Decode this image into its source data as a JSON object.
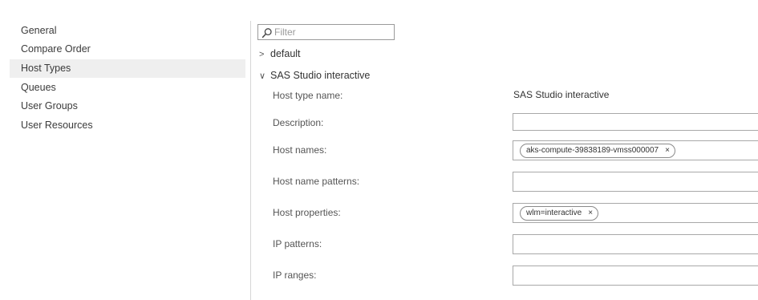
{
  "sidebar": {
    "items": [
      {
        "label": "General"
      },
      {
        "label": "Compare Order"
      },
      {
        "label": "Host Types"
      },
      {
        "label": "Queues"
      },
      {
        "label": "User Groups"
      },
      {
        "label": "User Resources"
      }
    ],
    "active_index": 2
  },
  "filter": {
    "placeholder": "Filter",
    "value": ""
  },
  "tree": {
    "collapsed_item": {
      "chevron": ">",
      "label": "default"
    },
    "expanded_item": {
      "chevron": "∨",
      "label": "SAS Studio interactive"
    }
  },
  "fields": {
    "host_type_name": {
      "label": "Host type name:",
      "value": "SAS Studio interactive"
    },
    "description": {
      "label": "Description:",
      "value": ""
    },
    "host_names": {
      "label": "Host names:",
      "chips": [
        "aks-compute-39838189-vmss000007"
      ]
    },
    "host_name_patterns": {
      "label": "Host name patterns:",
      "value": ""
    },
    "host_properties": {
      "label": "Host properties:",
      "chips": [
        "wlm=interactive"
      ]
    },
    "ip_patterns": {
      "label": "IP patterns:",
      "value": ""
    },
    "ip_ranges": {
      "label": "IP ranges:",
      "value": ""
    }
  },
  "chip_remove_glyph": "×"
}
